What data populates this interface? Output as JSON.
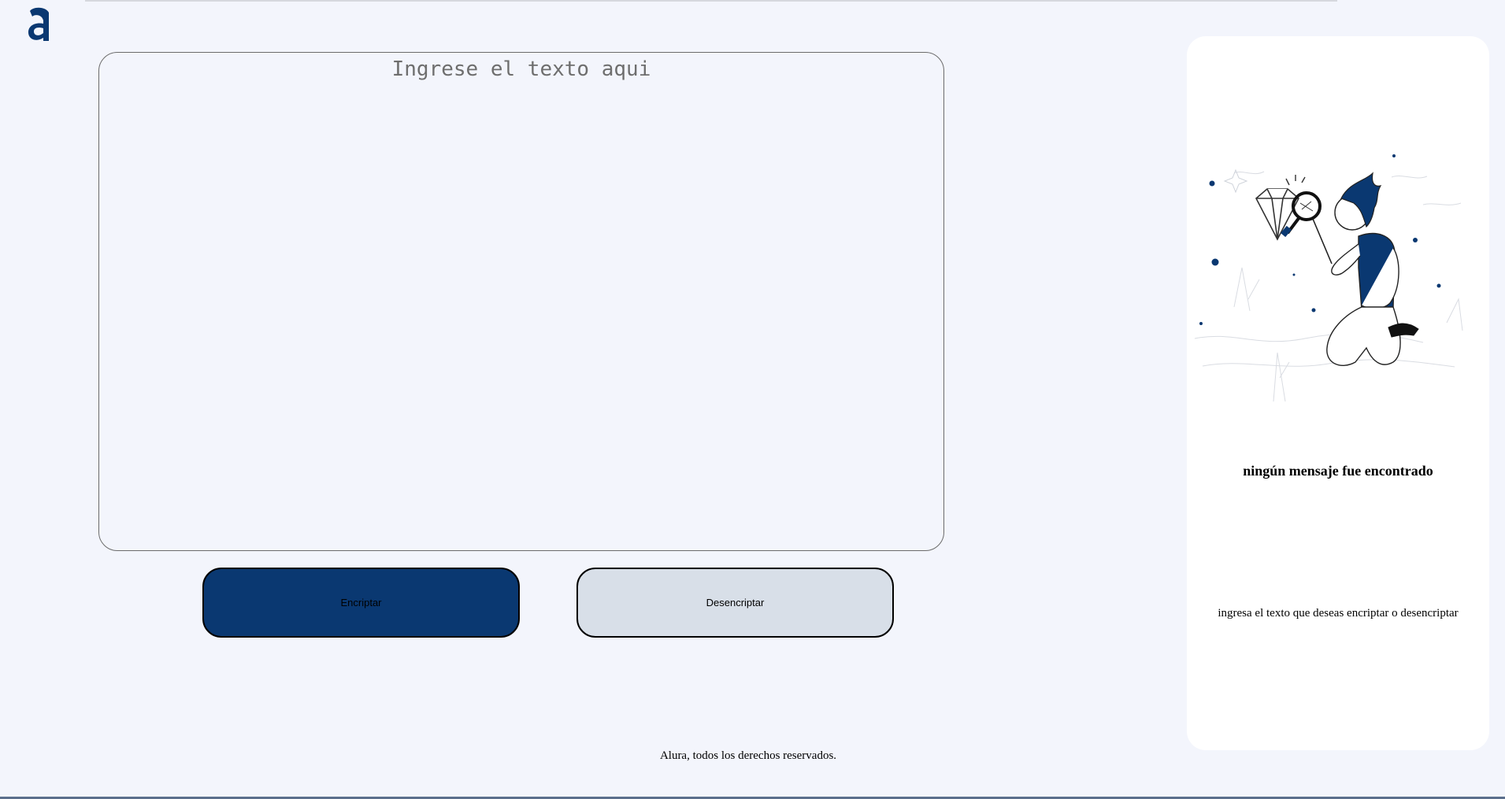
{
  "editor": {
    "placeholder": "Ingrese el texto aqui",
    "value": ""
  },
  "buttons": {
    "encrypt_label": "Encriptar",
    "decrypt_label": "Desencriptar"
  },
  "result_panel": {
    "title": "ningún mensaje fue encontrado",
    "message": "ingresa el texto que deseas encriptar o desencriptar"
  },
  "footer": {
    "text": "Alura, todos los derechos reservados."
  },
  "icons": {
    "logo": "alura-logo-icon",
    "illustration": "person-with-magnifier-illustration"
  },
  "colors": {
    "background": "#f3f5fc",
    "primary": "#0a3871",
    "secondary_button": "#d8dfe8",
    "panel": "#ffffff"
  }
}
